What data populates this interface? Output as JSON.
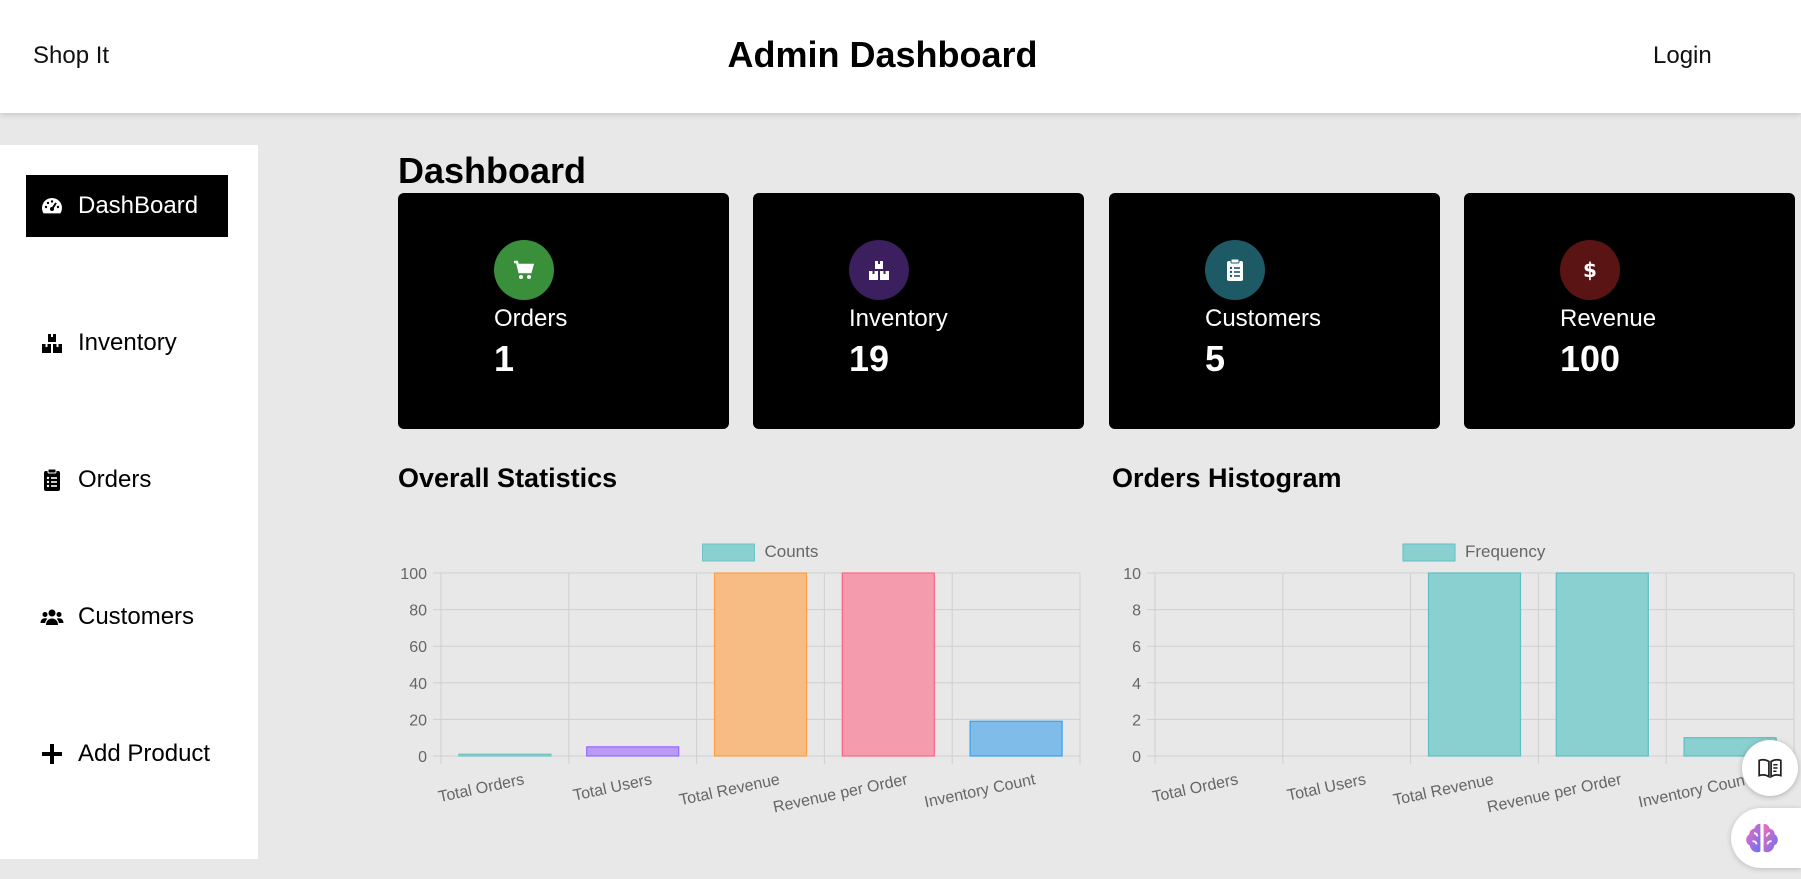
{
  "header": {
    "brand": "Shop It",
    "title": "Admin Dashboard",
    "login": "Login"
  },
  "sidebar": {
    "items": [
      {
        "label": "DashBoard",
        "icon": "speedometer-icon",
        "active": true
      },
      {
        "label": "Inventory",
        "icon": "boxes-icon",
        "active": false
      },
      {
        "label": "Orders",
        "icon": "clipboard-list-icon",
        "active": false
      },
      {
        "label": "Customers",
        "icon": "users-icon",
        "active": false
      },
      {
        "label": "Add Product",
        "icon": "plus-icon",
        "active": false
      }
    ]
  },
  "main": {
    "heading": "Dashboard",
    "cards": [
      {
        "label": "Orders",
        "value": "1",
        "icon": "cart-icon",
        "color": "#3a8f3a"
      },
      {
        "label": "Inventory",
        "value": "19",
        "icon": "boxes-icon",
        "color": "#3b1f5e"
      },
      {
        "label": "Customers",
        "value": "5",
        "icon": "clipboard-list-icon",
        "color": "#1d5a66"
      },
      {
        "label": "Revenue",
        "value": "100",
        "icon": "dollar-icon",
        "color": "#5b1414"
      }
    ],
    "stats_title": "Overall Statistics",
    "histogram_title": "Orders Histogram"
  },
  "chart_data": [
    {
      "type": "bar",
      "title": "Overall Statistics",
      "categories": [
        "Total Orders",
        "Total Users",
        "Total Revenue",
        "Revenue per Order",
        "Inventory Count"
      ],
      "series": [
        {
          "name": "Counts",
          "values": [
            1,
            5,
            100,
            100,
            19
          ]
        }
      ],
      "bar_colors": [
        "#9ad0d0",
        "#b99af5",
        "#f7bc83",
        "#f59bae",
        "#7fbcea"
      ],
      "bar_borders": [
        "#6ec4c4",
        "#9966ff",
        "#ff9f40",
        "#ff6384",
        "#36a2eb"
      ],
      "legend_color": "#8bd0d0",
      "ylim": [
        0,
        100
      ],
      "yticks": [
        0,
        20,
        40,
        60,
        80,
        100
      ],
      "grid": true,
      "legend": "top"
    },
    {
      "type": "bar",
      "title": "Orders Histogram",
      "categories": [
        "Total Orders",
        "Total Users",
        "Total Revenue",
        "Revenue per Order",
        "Inventory Count"
      ],
      "series": [
        {
          "name": "Frequency",
          "values": [
            0,
            0,
            10,
            10,
            1
          ]
        }
      ],
      "bar_color": "#8bd0d0",
      "bar_border": "#5cbfc4",
      "ylim": [
        0,
        10
      ],
      "yticks": [
        0,
        2,
        4,
        6,
        8,
        10
      ],
      "grid": true,
      "legend": "top"
    }
  ],
  "widgets": {
    "reader_icon": "book-reader-icon",
    "assistant_icon": "brain-icon"
  }
}
